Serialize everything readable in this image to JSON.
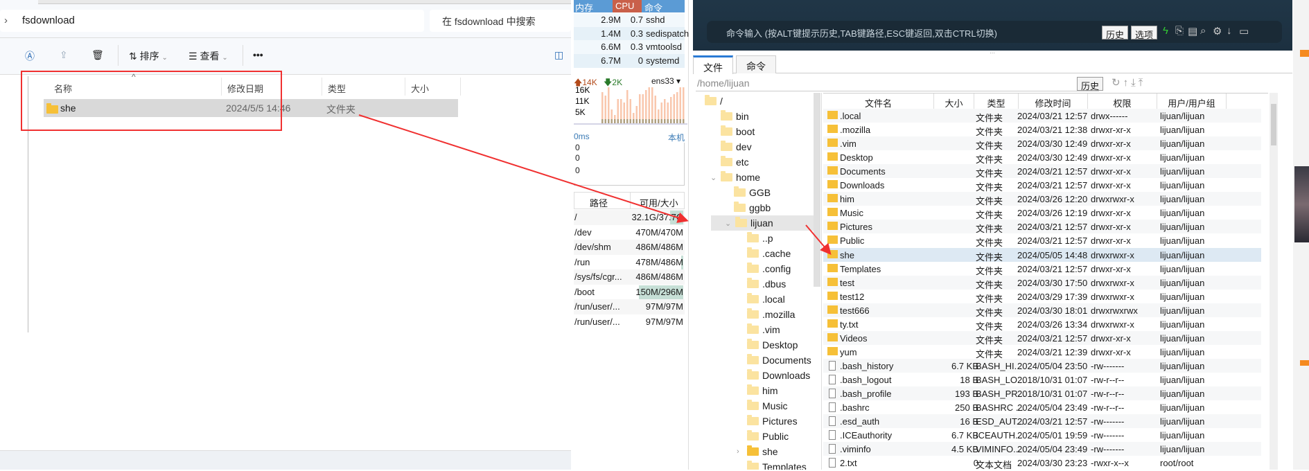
{
  "explorer": {
    "breadcrumb": "fsdownload",
    "search_placeholder": "在 fsdownload 中搜索",
    "toolbar": {
      "sort": "排序",
      "view": "查看",
      "more": "•••"
    },
    "columns": [
      "名称",
      "修改日期",
      "类型",
      "大小"
    ],
    "rows": [
      {
        "name": "she",
        "date": "2024/5/5 14:46",
        "type": "文件夹",
        "size": ""
      }
    ]
  },
  "monitor": {
    "proc_headers": [
      "内存",
      "CPU",
      "命令"
    ],
    "procs": [
      {
        "mem": "2.9M",
        "cpu": "0.7",
        "cmd": "sshd"
      },
      {
        "mem": "1.4M",
        "cpu": "0.3",
        "cmd": "sedispatch"
      },
      {
        "mem": "6.6M",
        "cpu": "0.3",
        "cmd": "vmtoolsd"
      },
      {
        "mem": "6.7M",
        "cpu": "0",
        "cmd": "systemd"
      }
    ],
    "net": {
      "up": "14K",
      "down": "2K",
      "iface": "ens33",
      "ticks": [
        "16K",
        "11K",
        "5K"
      ]
    },
    "latency": {
      "value": "0ms",
      "host": "本机",
      "ticks": [
        "0",
        "0",
        "0"
      ]
    },
    "disk_headers": [
      "路径",
      "可用/大小"
    ],
    "disks": [
      {
        "path": "/",
        "size": "32.1G/37.7G",
        "used": 0.15
      },
      {
        "path": "/dev",
        "size": "470M/470M",
        "used": 0
      },
      {
        "path": "/dev/shm",
        "size": "486M/486M",
        "used": 0
      },
      {
        "path": "/run",
        "size": "478M/486M",
        "used": 0.02
      },
      {
        "path": "/sys/fs/cgr...",
        "size": "486M/486M",
        "used": 0
      },
      {
        "path": "/boot",
        "size": "150M/296M",
        "used": 0.49
      },
      {
        "path": "/run/user/...",
        "size": "97M/97M",
        "used": 0
      },
      {
        "path": "/run/user/...",
        "size": "97M/97M",
        "used": 0
      }
    ]
  },
  "terminal": {
    "hint": "命令输入 (按ALT键提示历史,TAB键路径,ESC键返回,双击CTRL切换)",
    "history": "历史",
    "options": "选项"
  },
  "tabs": [
    "文件",
    "命令"
  ],
  "path": {
    "value": "/home/lijuan",
    "history": "历史"
  },
  "tree": [
    {
      "label": "/",
      "lvl": 0
    },
    {
      "label": "bin",
      "lvl": 1
    },
    {
      "label": "boot",
      "lvl": 1
    },
    {
      "label": "dev",
      "lvl": 1
    },
    {
      "label": "etc",
      "lvl": 1
    },
    {
      "label": "home",
      "lvl": 1,
      "open": true
    },
    {
      "label": "GGB",
      "lvl": 2
    },
    {
      "label": "ggbb",
      "lvl": 2
    },
    {
      "label": "lijuan",
      "lvl": 2,
      "open": true,
      "sel": true
    },
    {
      "label": "..p",
      "lvl": 3
    },
    {
      "label": ".cache",
      "lvl": 3
    },
    {
      "label": ".config",
      "lvl": 3
    },
    {
      "label": ".dbus",
      "lvl": 3
    },
    {
      "label": ".local",
      "lvl": 3
    },
    {
      "label": ".mozilla",
      "lvl": 3
    },
    {
      "label": ".vim",
      "lvl": 3
    },
    {
      "label": "Desktop",
      "lvl": 3
    },
    {
      "label": "Documents",
      "lvl": 3
    },
    {
      "label": "Downloads",
      "lvl": 3
    },
    {
      "label": "him",
      "lvl": 3
    },
    {
      "label": "Music",
      "lvl": 3
    },
    {
      "label": "Pictures",
      "lvl": 3
    },
    {
      "label": "Public",
      "lvl": 3
    },
    {
      "label": "she",
      "lvl": 3,
      "dark": true,
      "caret": true
    },
    {
      "label": "Templates",
      "lvl": 3
    }
  ],
  "file_columns": [
    "文件名",
    "大小",
    "类型",
    "修改时间",
    "权限",
    "用户/用户组"
  ],
  "files": [
    {
      "name": ".local",
      "size": "",
      "type": "文件夹",
      "time": "2024/03/21 12:57",
      "perm": "drwx------",
      "owner": "lijuan/lijuan",
      "dir": true
    },
    {
      "name": ".mozilla",
      "size": "",
      "type": "文件夹",
      "time": "2024/03/21 12:38",
      "perm": "drwxr-xr-x",
      "owner": "lijuan/lijuan",
      "dir": true
    },
    {
      "name": ".vim",
      "size": "",
      "type": "文件夹",
      "time": "2024/03/30 12:49",
      "perm": "drwxr-xr-x",
      "owner": "lijuan/lijuan",
      "dir": true
    },
    {
      "name": "Desktop",
      "size": "",
      "type": "文件夹",
      "time": "2024/03/30 12:49",
      "perm": "drwxr-xr-x",
      "owner": "lijuan/lijuan",
      "dir": true
    },
    {
      "name": "Documents",
      "size": "",
      "type": "文件夹",
      "time": "2024/03/21 12:57",
      "perm": "drwxr-xr-x",
      "owner": "lijuan/lijuan",
      "dir": true
    },
    {
      "name": "Downloads",
      "size": "",
      "type": "文件夹",
      "time": "2024/03/21 12:57",
      "perm": "drwxr-xr-x",
      "owner": "lijuan/lijuan",
      "dir": true
    },
    {
      "name": "him",
      "size": "",
      "type": "文件夹",
      "time": "2024/03/26 12:20",
      "perm": "drwxrwxr-x",
      "owner": "lijuan/lijuan",
      "dir": true
    },
    {
      "name": "Music",
      "size": "",
      "type": "文件夹",
      "time": "2024/03/26 12:19",
      "perm": "drwxr-xr-x",
      "owner": "lijuan/lijuan",
      "dir": true
    },
    {
      "name": "Pictures",
      "size": "",
      "type": "文件夹",
      "time": "2024/03/21 12:57",
      "perm": "drwxr-xr-x",
      "owner": "lijuan/lijuan",
      "dir": true
    },
    {
      "name": "Public",
      "size": "",
      "type": "文件夹",
      "time": "2024/03/21 12:57",
      "perm": "drwxr-xr-x",
      "owner": "lijuan/lijuan",
      "dir": true
    },
    {
      "name": "she",
      "size": "",
      "type": "文件夹",
      "time": "2024/05/05 14:48",
      "perm": "drwxrwxr-x",
      "owner": "lijuan/lijuan",
      "dir": true,
      "sel": true
    },
    {
      "name": "Templates",
      "size": "",
      "type": "文件夹",
      "time": "2024/03/21 12:57",
      "perm": "drwxr-xr-x",
      "owner": "lijuan/lijuan",
      "dir": true
    },
    {
      "name": "test",
      "size": "",
      "type": "文件夹",
      "time": "2024/03/30 17:50",
      "perm": "drwxrwxr-x",
      "owner": "lijuan/lijuan",
      "dir": true
    },
    {
      "name": "test12",
      "size": "",
      "type": "文件夹",
      "time": "2024/03/29 17:39",
      "perm": "drwxrwxr-x",
      "owner": "lijuan/lijuan",
      "dir": true
    },
    {
      "name": "test666",
      "size": "",
      "type": "文件夹",
      "time": "2024/03/30 18:01",
      "perm": "drwxrwxrwx",
      "owner": "lijuan/lijuan",
      "dir": true
    },
    {
      "name": "ty.txt",
      "size": "",
      "type": "文件夹",
      "time": "2024/03/26 13:34",
      "perm": "drwxrwxr-x",
      "owner": "lijuan/lijuan",
      "dir": true
    },
    {
      "name": "Videos",
      "size": "",
      "type": "文件夹",
      "time": "2024/03/21 12:57",
      "perm": "drwxr-xr-x",
      "owner": "lijuan/lijuan",
      "dir": true
    },
    {
      "name": "yum",
      "size": "",
      "type": "文件夹",
      "time": "2024/03/21 12:39",
      "perm": "drwxr-xr-x",
      "owner": "lijuan/lijuan",
      "dir": true
    },
    {
      "name": ".bash_history",
      "size": "6.7 KB",
      "type": "BASH_HI...",
      "time": "2024/05/04 23:50",
      "perm": "-rw-------",
      "owner": "lijuan/lijuan"
    },
    {
      "name": ".bash_logout",
      "size": "18 B",
      "type": "BASH_LO...",
      "time": "2018/10/31 01:07",
      "perm": "-rw-r--r--",
      "owner": "lijuan/lijuan"
    },
    {
      "name": ".bash_profile",
      "size": "193 B",
      "type": "BASH_PR...",
      "time": "2018/10/31 01:07",
      "perm": "-rw-r--r--",
      "owner": "lijuan/lijuan"
    },
    {
      "name": ".bashrc",
      "size": "250 B",
      "type": "BASHRC ...",
      "time": "2024/05/04 23:49",
      "perm": "-rw-r--r--",
      "owner": "lijuan/lijuan"
    },
    {
      "name": ".esd_auth",
      "size": "16 B",
      "type": "ESD_AUT...",
      "time": "2024/03/21 12:57",
      "perm": "-rw-------",
      "owner": "lijuan/lijuan"
    },
    {
      "name": ".ICEauthority",
      "size": "6.7 KB",
      "type": "ICEAUTH...",
      "time": "2024/05/01 19:59",
      "perm": "-rw-------",
      "owner": "lijuan/lijuan"
    },
    {
      "name": ".viminfo",
      "size": "4.5 KB",
      "type": "VIMINFO...",
      "time": "2024/05/04 23:49",
      "perm": "-rw-------",
      "owner": "lijuan/lijuan"
    },
    {
      "name": "2.txt",
      "size": "0",
      "type": "文本文档",
      "time": "2024/03/30 23:23",
      "perm": "-rwxr-x--x",
      "owner": "root/root"
    }
  ],
  "colors": {
    "annotation_red": "#f03030",
    "cpu_header": "#c9604a",
    "header_blue": "#5b9bd5",
    "folder": "#f6c038"
  }
}
